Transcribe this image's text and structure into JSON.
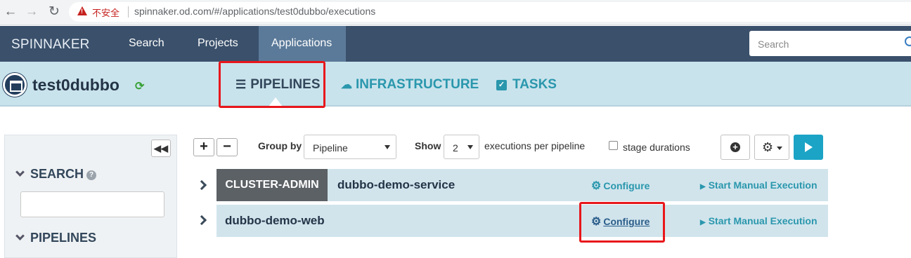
{
  "browser": {
    "insecure_label": "不安全",
    "url": "spinnaker.od.com/#/applications/test0dubbo/executions"
  },
  "topnav": {
    "brand": "SPINNAKER",
    "links": [
      "Search",
      "Projects",
      "Applications"
    ],
    "active": "Applications",
    "search_placeholder": "Search"
  },
  "app": {
    "name": "test0dubbo",
    "tabs": [
      {
        "label": "PIPELINES",
        "icon": "list-icon",
        "active": true
      },
      {
        "label": "INFRASTRUCTURE",
        "icon": "cloud-icon",
        "active": false
      },
      {
        "label": "TASKS",
        "icon": "checkbox-icon",
        "active": false
      }
    ]
  },
  "sidebar": {
    "collapse_glyph": "◀◀",
    "search_heading": "SEARCH",
    "help_glyph": "?",
    "search_value": "",
    "pipelines_heading": "PIPELINES"
  },
  "toolbar": {
    "add_glyph": "+",
    "remove_glyph": "−",
    "group_by_label": "Group by",
    "group_by_value": "Pipeline",
    "show_label": "Show",
    "show_value": "2",
    "per_pipeline_label": "executions per pipeline",
    "stage_durations_label": "stage durations",
    "stage_durations_checked": false
  },
  "pipelines": [
    {
      "tag": "CLUSTER-ADMIN",
      "name": "dubbo-demo-service",
      "configure": "Configure",
      "start": "Start Manual Execution"
    },
    {
      "tag": "",
      "name": "dubbo-demo-web",
      "configure": "Configure",
      "start": "Start Manual Execution"
    }
  ],
  "colors": {
    "nav_bg": "#3a506b",
    "header_bg": "#c9e3ec",
    "accent": "#2a97ad",
    "play_button": "#1ba4c6",
    "highlight_box": "#e8171c"
  }
}
